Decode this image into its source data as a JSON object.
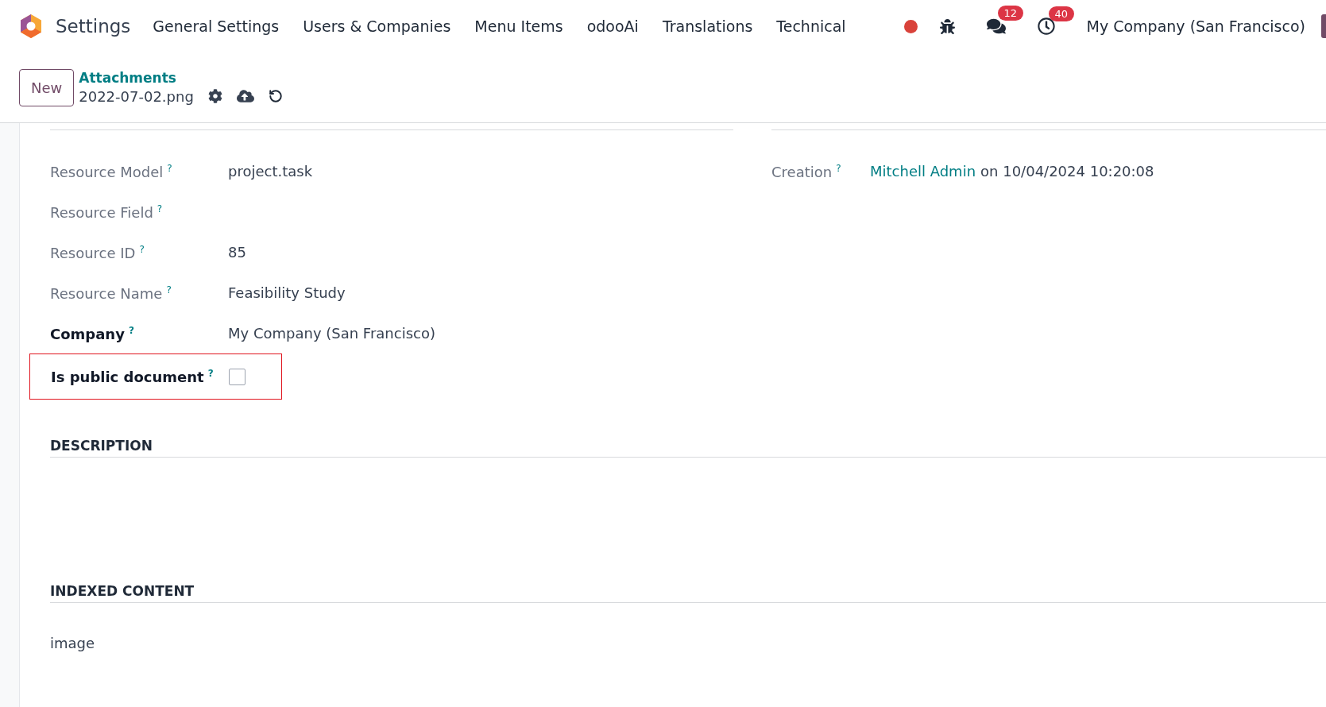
{
  "navbar": {
    "app_name": "Settings",
    "menu": [
      "General Settings",
      "Users & Companies",
      "Menu Items",
      "odooAi",
      "Translations",
      "Technical"
    ],
    "messages_count": "12",
    "activities_count": "40",
    "company": "My Company (San Francisco)"
  },
  "control_panel": {
    "new_button": "New",
    "breadcrumb": "Attachments",
    "record_name": "2022-07-02.png"
  },
  "left_fields": [
    {
      "label": "Resource Model",
      "help": "?",
      "value": "project.task",
      "required": false,
      "highlighted": false,
      "kind": "text"
    },
    {
      "label": "Resource Field",
      "help": "?",
      "required": false,
      "highlighted": false,
      "kind": "text"
    },
    {
      "label": "Resource ID",
      "help": "?",
      "value": "85",
      "required": false,
      "highlighted": false,
      "kind": "text"
    },
    {
      "label": "Resource Name",
      "help": "?",
      "value": "Feasibility Study",
      "required": false,
      "highlighted": false,
      "kind": "text"
    },
    {
      "label": "Company",
      "help": "?",
      "value": "My Company (San Francisco)",
      "required": true,
      "highlighted": false,
      "kind": "text"
    },
    {
      "label": "Is public document",
      "help": "?",
      "checked": false,
      "required": true,
      "highlighted": true,
      "kind": "checkbox"
    }
  ],
  "creation": {
    "label": "Creation",
    "help": "?",
    "user": "Mitchell Admin",
    "date_text": "on 10/04/2024 10:20:08"
  },
  "description": {
    "title": "DESCRIPTION"
  },
  "indexed_content": {
    "title": "INDEXED CONTENT",
    "text": "image"
  }
}
